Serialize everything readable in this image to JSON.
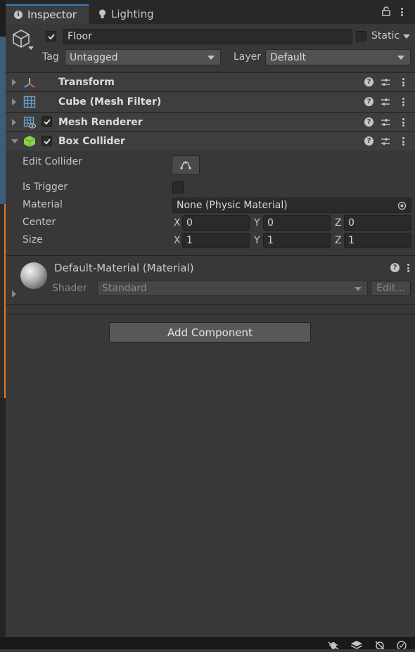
{
  "tabs": [
    {
      "label": "Inspector",
      "icon": "info-icon"
    },
    {
      "label": "Lighting",
      "icon": "bulb-icon"
    }
  ],
  "header": {
    "object_name": "Floor",
    "active": true,
    "static_label": "Static",
    "tag_label": "Tag",
    "tag_value": "Untagged",
    "layer_label": "Layer",
    "layer_value": "Default"
  },
  "components": [
    {
      "name": "Transform",
      "icon": "transform-icon",
      "has_checkbox": false,
      "expanded": false
    },
    {
      "name": "Cube (Mesh Filter)",
      "icon": "mesh-filter-icon",
      "has_checkbox": false,
      "expanded": false
    },
    {
      "name": "Mesh Renderer",
      "icon": "mesh-renderer-icon",
      "has_checkbox": true,
      "enabled": true,
      "expanded": false
    },
    {
      "name": "Box Collider",
      "icon": "box-collider-icon",
      "has_checkbox": true,
      "enabled": true,
      "expanded": true
    }
  ],
  "box_collider": {
    "edit_collider_label": "Edit Collider",
    "is_trigger_label": "Is Trigger",
    "is_trigger": false,
    "material_label": "Material",
    "material_value": "None (Physic Material)",
    "center_label": "Center",
    "center": {
      "x": "0",
      "y": "0",
      "z": "0"
    },
    "size_label": "Size",
    "size": {
      "x": "1",
      "y": "1",
      "z": "1"
    },
    "axis_labels": {
      "x": "X",
      "y": "Y",
      "z": "Z"
    }
  },
  "material": {
    "name": "Default-Material (Material)",
    "shader_label": "Shader",
    "shader_value": "Standard",
    "edit_label": "Edit..."
  },
  "add_component_label": "Add Component",
  "colors": {
    "background": "#383838",
    "tab_accent": "#3a79bb",
    "box_collider_green": "#8fd444",
    "selection_orange": "#e8761d"
  }
}
